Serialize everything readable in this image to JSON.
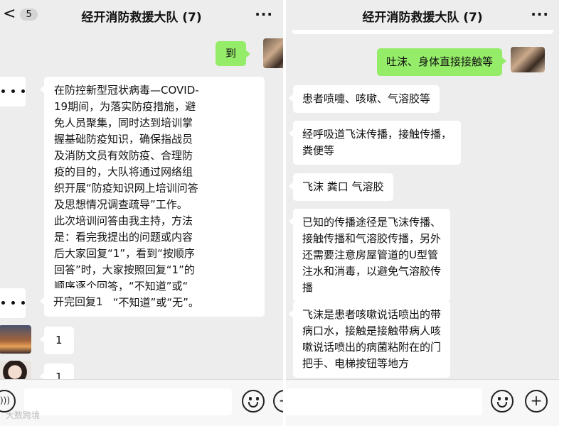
{
  "left": {
    "header": {
      "title": "经开消防救援大队 (7)",
      "back": "<",
      "unread": "5",
      "more": "···"
    },
    "messages": {
      "sent_1": "到",
      "notice_lines": [
        "在防控新型冠状病毒—COVID-",
        "19期间，为落实防疫措施，避",
        "免人员聚集，同时达到培训掌",
        "握基础防疫知识，确保指战员",
        "及消防文员有效防疫、合理防",
        "疫的目的，大队将通过网络组",
        "织开展“防疫知识网上培训问答",
        "及思想情况调查疏导”工作。",
        "此次培训问答由我主持，方法",
        "是：看完我提出的问题或内容",
        "后大家回复“1”，看到“按顺序",
        "回答”时，大家按照回复“1”的",
        "顺序逐个回答，“不知道”或“",
        "无”直接回复“不知道”或“无”。"
      ],
      "start_reply": "开完回复1",
      "reply_a": "1",
      "reply_b": "1"
    },
    "icons": {
      "voice": "voice-icon",
      "emoji": "emoji-icon",
      "plus": "add-icon"
    }
  },
  "right": {
    "header": {
      "title": "经开消防救援大队 (7)",
      "more": "···"
    },
    "messages": {
      "sent_1": "吐沫、身体直接接触等",
      "reply_1": "患者喷嚏、咳嗽、气溶胶等",
      "reply_2_lines": [
        "经呼吸道飞沫传播，接触传播，",
        "粪便等"
      ],
      "reply_3": "飞沫 粪口 气溶胶",
      "reply_4_lines": [
        "已知的传播途径是飞沫传播、",
        "接触传播和气溶胶传播，另外",
        "还需要注意房屋管道的U型管",
        "注水和消毒，以避免气溶胶传",
        "播"
      ],
      "reply_5_lines": [
        "飞沫是患者咳嗽说话喷出的带",
        "病口水，接触是接触带病人咳",
        "嗽说话喷出的病菌粘附在的门",
        "把手、电梯按钮等地方"
      ]
    },
    "icons": {
      "emoji": "emoji-icon",
      "plus": "add-icon"
    }
  },
  "watermark": "大数跨境",
  "colors": {
    "sent_bubble": "#95ec69",
    "received_bubble": "#ffffff",
    "chat_bg": "#ededed"
  }
}
